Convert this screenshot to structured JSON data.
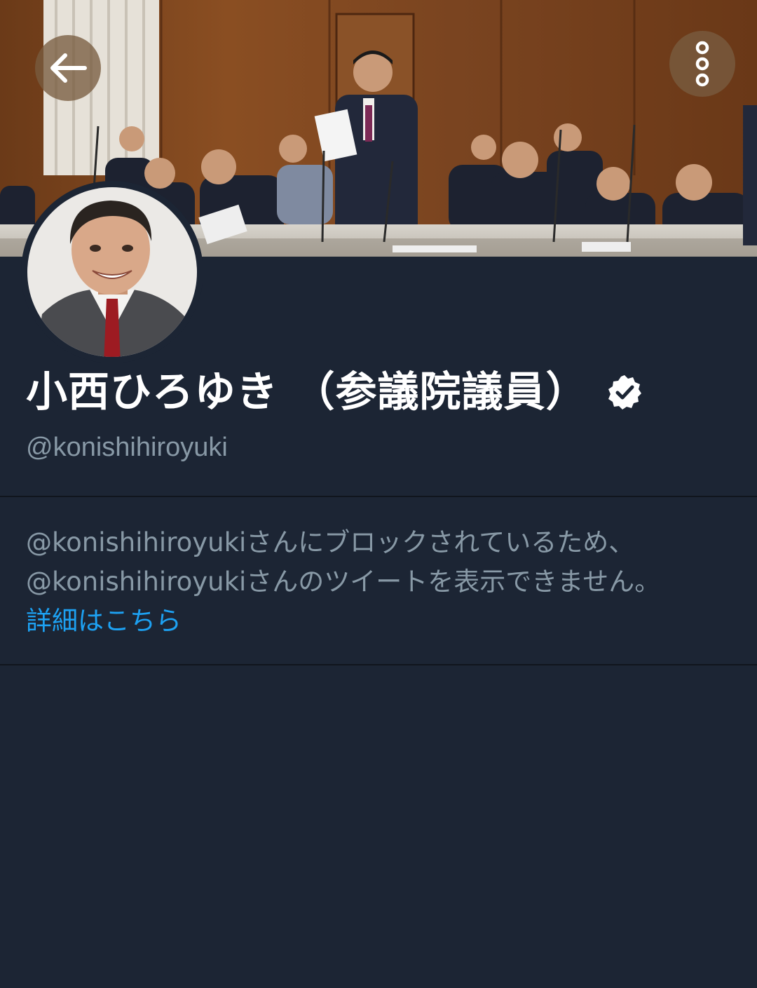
{
  "header": {
    "back_icon": "arrow-left-icon",
    "more_icon": "vertical-ellipsis-icon"
  },
  "profile": {
    "display_name": "小西ひろゆき （参議院議員）",
    "verified_icon": "verified-badge-icon",
    "handle": "@konishihiroyuki"
  },
  "blocked_notice": {
    "line_1": "@konishihiroyukiさんにブロックされているため、",
    "line_2": "@konishihiroyukiさんのツイートを表示できません。",
    "learn_more_label": "詳細はこちら"
  },
  "colors": {
    "background": "#1c2534",
    "primary_text": "#ffffff",
    "secondary_text": "#8899a6",
    "link": "#1da1f2",
    "divider": "#10151d"
  }
}
